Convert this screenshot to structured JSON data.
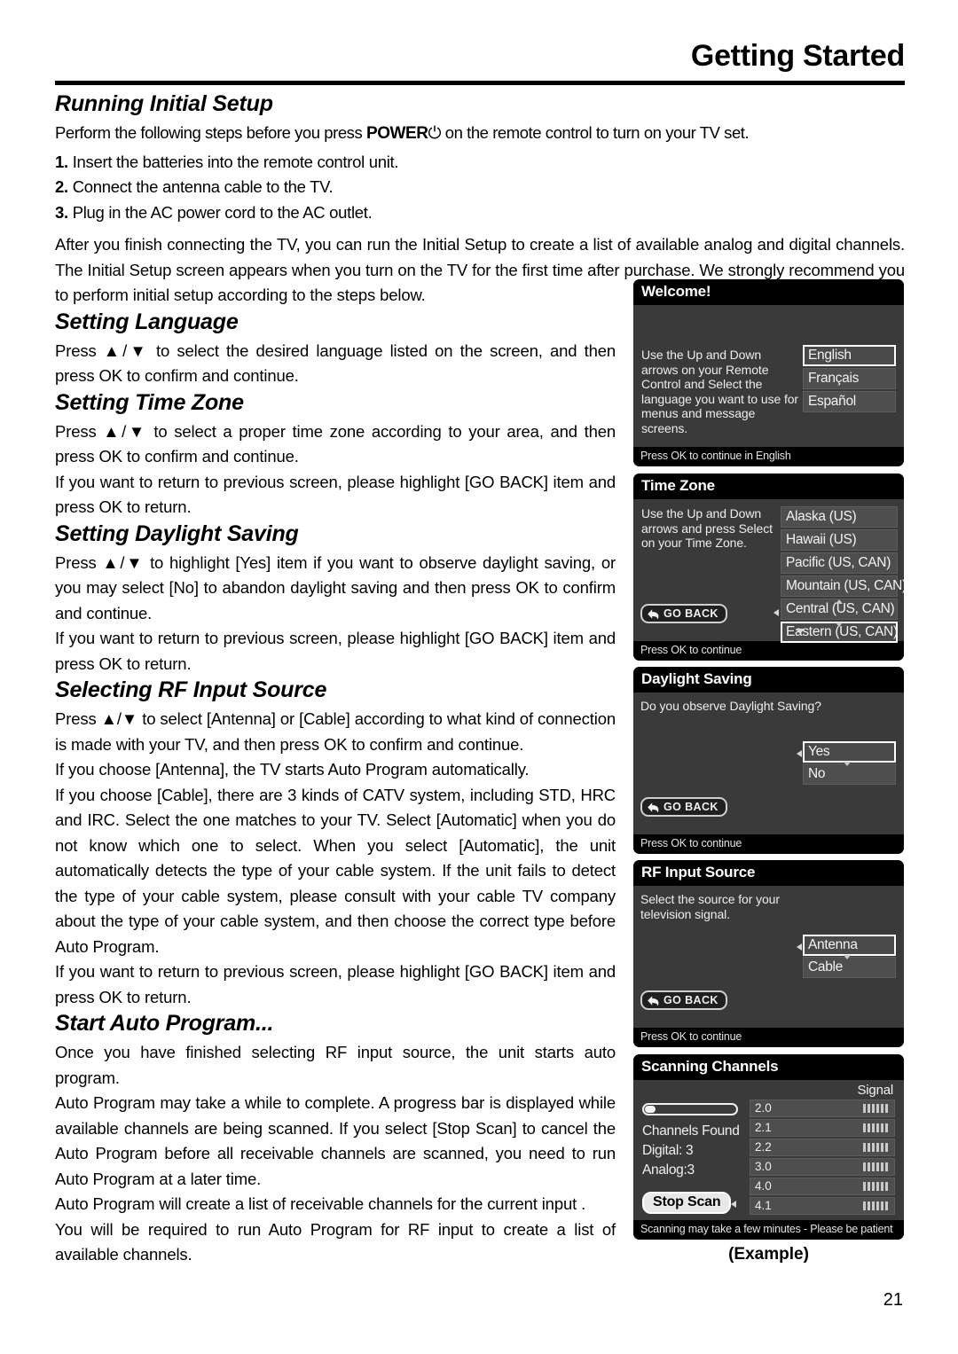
{
  "header": {
    "title": "Getting Started"
  },
  "sections": {
    "running_initial_setup": {
      "heading": "Running Initial Setup",
      "intro_before": "Perform the following steps before you press ",
      "intro_bold": "POWER",
      "intro_icon": "⏻",
      "intro_after": " on the remote control to turn on your TV set.",
      "steps": [
        {
          "num": "1.",
          "text": "Insert the batteries into the remote control unit."
        },
        {
          "num": "2.",
          "text": "Connect the antenna cable to the TV."
        },
        {
          "num": "3.",
          "text": "Plug in the AC power cord to the AC outlet."
        }
      ],
      "paragraph": "After you finish connecting the TV, you can run the Initial Setup to create a list of available analog and digital channels. The Initial Setup screen appears when you turn on the TV for the first time after purchase. We strongly recommend you to perform initial setup according to the steps below."
    },
    "setting_language": {
      "heading": "Setting Language",
      "paragraph": "Press ▲/▼ to select the desired language listed on the screen, and then press OK to confirm and continue."
    },
    "setting_time_zone": {
      "heading": "Setting Time Zone",
      "paragraph_1": "Press ▲/▼ to select a proper time zone according to your area, and then press OK to confirm and continue.",
      "paragraph_2": "If you want to return to previous screen, please highlight [GO BACK] item and press OK to return."
    },
    "setting_daylight_saving": {
      "heading": "Setting Daylight Saving",
      "paragraph_1": "Press ▲/▼ to highlight [Yes] item if you want to observe daylight saving, or you may select [No] to abandon daylight saving and then press OK to confirm and continue.",
      "paragraph_2": "If you want to return to previous screen, please highlight [GO BACK] item and press OK to return."
    },
    "selecting_rf_input_source": {
      "heading": "Selecting RF Input Source",
      "paragraph_1": "Press ▲/▼ to select [Antenna] or [Cable] according to what kind of connection is made with your TV, and then press OK to confirm and continue.",
      "paragraph_2": "If you choose [Antenna], the TV starts Auto Program automatically.",
      "paragraph_3": "If you choose [Cable], there are 3 kinds of CATV system, including STD, HRC and IRC. Select the one matches to your TV. Select [Automatic] when you do not know which one to select. When you select [Automatic], the unit automatically detects the type of your cable system. If the unit fails to detect the type of your cable system, please consult with your cable TV company about the type of your cable system, and then choose the correct type before Auto Program.",
      "paragraph_4": "If you want to return to previous screen, please highlight [GO BACK] item and press OK to return."
    },
    "start_auto_program": {
      "heading": "Start Auto Program...",
      "paragraph_1": "Once you have finished selecting RF input source, the unit starts auto program.",
      "paragraph_2": "Auto Program may take a while to complete. A progress bar is displayed while available channels are being scanned. If you select [Stop Scan] to cancel the Auto Program before all receivable channels are scanned, you need to run Auto Program at a later time.",
      "paragraph_3": "Auto Program will create a list of receivable channels for the current input .",
      "paragraph_4": "You will be required to run Auto Program for RF input to create a list of available channels."
    }
  },
  "screens": {
    "welcome": {
      "title": "Welcome!",
      "description": "Use the Up and Down arrows on your Remote Control and Select the language you want to use for menus and message screens.",
      "options": [
        {
          "label": "English",
          "selected": true
        },
        {
          "label": "Français",
          "selected": false
        },
        {
          "label": "Español",
          "selected": false
        }
      ],
      "footer": "Press OK to continue in English"
    },
    "time_zone": {
      "title": "Time Zone",
      "description": "Use the Up and Down arrows and press Select on your Time Zone.",
      "options": [
        {
          "label": "Alaska (US)",
          "selected": false
        },
        {
          "label": "Hawaii (US)",
          "selected": false
        },
        {
          "label": "Pacific (US, CAN)",
          "selected": false
        },
        {
          "label": "Mountain (US, CAN)",
          "selected": false
        },
        {
          "label": "Central (US, CAN)",
          "selected": false
        },
        {
          "label": "Eastern (US, CAN)",
          "selected": true
        }
      ],
      "go_back": "GO BACK",
      "footer": "Press OK to continue"
    },
    "daylight_saving": {
      "title": "Daylight Saving",
      "description": "Do you observe Daylight Saving?",
      "options": [
        {
          "label": "Yes",
          "selected": true
        },
        {
          "label": "No",
          "selected": false
        }
      ],
      "go_back": "GO BACK",
      "footer": "Press OK to continue"
    },
    "rf_input_source": {
      "title": "RF Input Source",
      "description": "Select the source for your television signal.",
      "options": [
        {
          "label": "Antenna",
          "selected": true
        },
        {
          "label": "Cable",
          "selected": false
        }
      ],
      "go_back": "GO BACK",
      "footer": "Press OK to continue"
    },
    "scanning_channels": {
      "title": "Scanning Channels",
      "signal_header": "Signal",
      "progress_percent": 12,
      "channels_found_label": "Channels Found",
      "digital_label": "Digital: 3",
      "analog_label": "Analog:3",
      "channels": [
        {
          "name": "2.0",
          "signal_bars": 6
        },
        {
          "name": "2.1",
          "signal_bars": 6
        },
        {
          "name": "2.2",
          "signal_bars": 6
        },
        {
          "name": "3.0",
          "signal_bars": 6
        },
        {
          "name": "4.0",
          "signal_bars": 6
        },
        {
          "name": "4.1",
          "signal_bars": 6
        }
      ],
      "stop_scan": "Stop Scan",
      "footer": "Scanning may take a few minutes - Please be patient"
    }
  },
  "example_caption": "(Example)",
  "page_number": "21"
}
